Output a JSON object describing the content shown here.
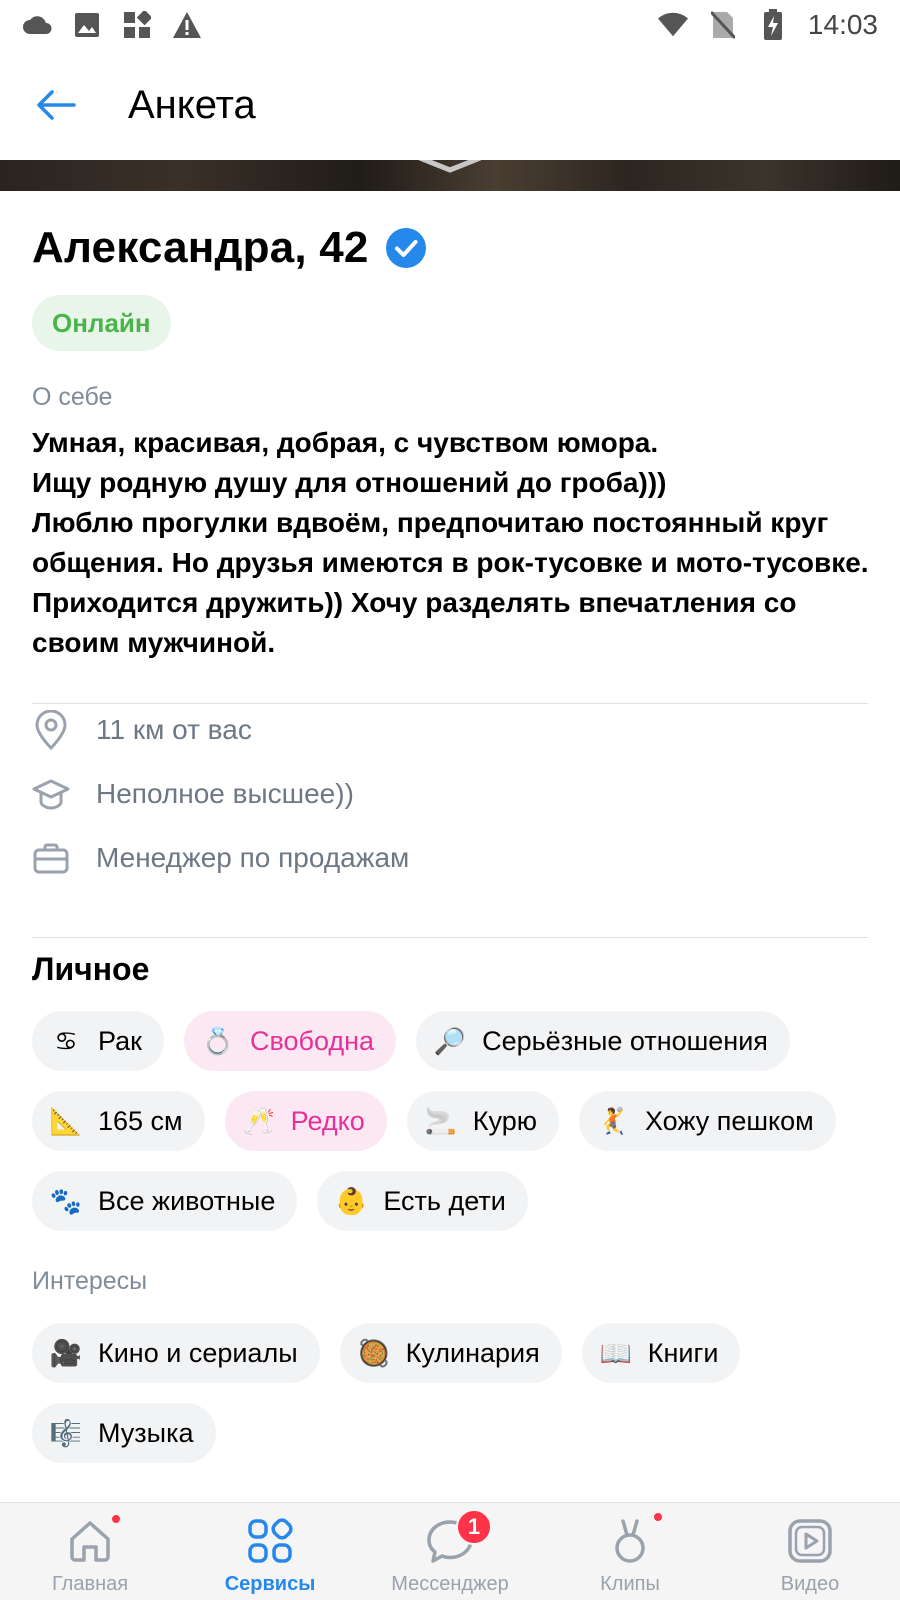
{
  "status_bar": {
    "time": "14:03",
    "left_icons": [
      "cloud-icon",
      "image-icon",
      "apps-icon",
      "warning-icon"
    ],
    "right_icons": [
      "wifi-icon",
      "no-sim-icon",
      "battery-charging-icon"
    ]
  },
  "header": {
    "title": "Анкета",
    "back_icon": "arrow-left-icon"
  },
  "profile": {
    "name": "Александра, 42",
    "verified_icon": "verified-check-icon",
    "status": "Онлайн",
    "about_label": "О себе",
    "about_text": "Умная, красивая, добрая, с чувством юмора.\nИщу родную душу для отношений до гроба)))\nЛюблю прогулки вдвоём, предпочитаю постоянный круг общения. Но друзья имеются в рок-тусовке и мото-тусовке. Приходится дружить)) Хочу разделять впечатления со своим мужчиной.",
    "info": [
      {
        "icon": "location-pin-icon",
        "text": "11 км от вас"
      },
      {
        "icon": "graduation-cap-icon",
        "text": "Неполное высшее))"
      },
      {
        "icon": "briefcase-icon",
        "text": "Менеджер по продажам"
      }
    ]
  },
  "personal": {
    "title": "Личное",
    "chips": [
      {
        "icon": "♋",
        "label": "Рак",
        "highlight": false
      },
      {
        "icon": "💍",
        "label": "Свободна",
        "highlight": true
      },
      {
        "icon": "🔎",
        "label": "Серьёзные отношения",
        "highlight": false
      },
      {
        "icon": "📐",
        "label": "165 см",
        "highlight": false
      },
      {
        "icon": "🥂",
        "label": "Редко",
        "highlight": true
      },
      {
        "icon": "🚬",
        "label": "Курю",
        "highlight": false
      },
      {
        "icon": "🤾",
        "label": "Хожу пешком",
        "highlight": false
      },
      {
        "icon": "🐾",
        "label": "Все животные",
        "highlight": false
      },
      {
        "icon": "👶",
        "label": "Есть дети",
        "highlight": false
      }
    ]
  },
  "interests": {
    "label": "Интересы",
    "chips": [
      {
        "icon": "🎥",
        "label": "Кино и сериалы"
      },
      {
        "icon": "🥘",
        "label": "Кулинария"
      },
      {
        "icon": "📖",
        "label": "Книги"
      },
      {
        "icon": "🎼",
        "label": "Музыка"
      }
    ]
  },
  "tabbar": {
    "tabs": [
      {
        "label": "Главная",
        "icon": "home-icon",
        "active": false,
        "dot": true
      },
      {
        "label": "Сервисы",
        "icon": "services-grid-icon",
        "active": true,
        "dot": false
      },
      {
        "label": "Мессенджер",
        "icon": "message-bubble-icon",
        "active": false,
        "counter": "1"
      },
      {
        "label": "Клипы",
        "icon": "clips-icon",
        "active": false,
        "dot": true
      },
      {
        "label": "Видео",
        "icon": "video-play-icon",
        "active": false,
        "dot": false
      }
    ]
  },
  "colors": {
    "accent": "#2688eb",
    "online": "#4bb34b",
    "highlight_text": "#e6319a",
    "highlight_bg": "#fce8f2",
    "badge": "#ff3347"
  }
}
